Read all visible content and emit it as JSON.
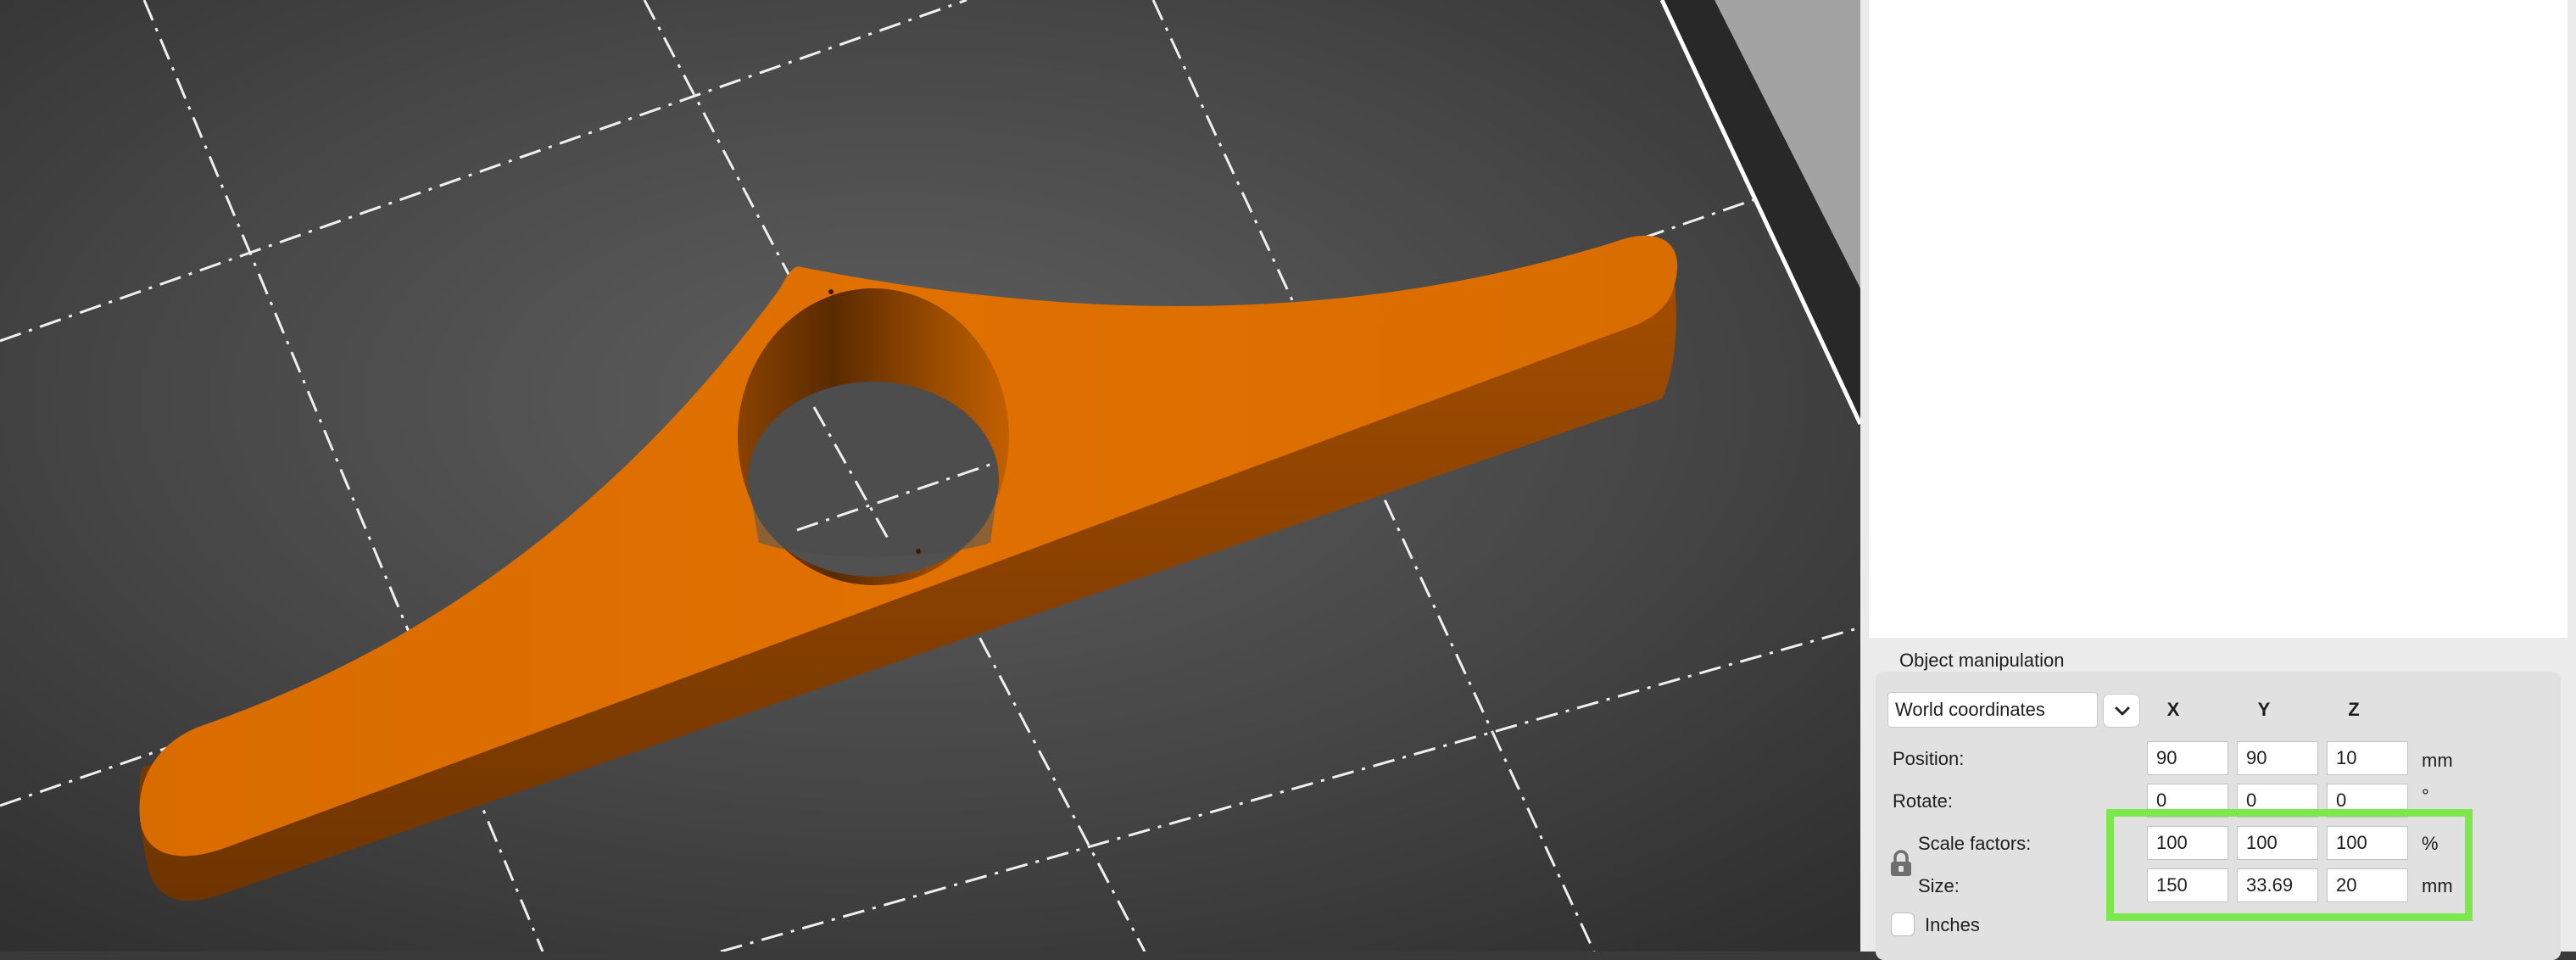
{
  "colors": {
    "bed": "#3a3a3a",
    "model": "#e07000",
    "highlight": "#7de84e",
    "panel": "#e1e1e1"
  },
  "object_manipulation": {
    "title": "Object manipulation",
    "coordinate_system": "World coordinates",
    "dropdown_icon": "chevron-down-icon",
    "axis_labels": {
      "x": "X",
      "y": "Y",
      "z": "Z"
    },
    "position": {
      "label": "Position:",
      "x": "90",
      "y": "90",
      "z": "10",
      "unit": "mm"
    },
    "rotate": {
      "label": "Rotate:",
      "x": "0",
      "y": "0",
      "z": "0",
      "unit": "°"
    },
    "scale_factors": {
      "label": "Scale factors:",
      "x": "100",
      "y": "100",
      "z": "100",
      "unit": "%"
    },
    "size": {
      "label": "Size:",
      "x": "150",
      "y": "33.69",
      "z": "20",
      "unit": "mm"
    },
    "lock_icon": "lock-icon",
    "inches": {
      "label": "Inches",
      "checked": false
    }
  }
}
